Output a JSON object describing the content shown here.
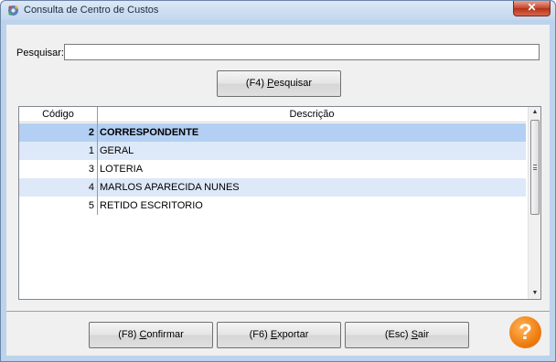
{
  "window": {
    "title": "Consulta de Centro de Custos",
    "close_glyph": "✕"
  },
  "search": {
    "label": "Pesquisar:",
    "value": "",
    "button_prefix": "(F4) ",
    "button_mnemonic": "P",
    "button_rest": "esquisar"
  },
  "grid": {
    "columns": [
      "Código",
      "Descrição"
    ],
    "rows": [
      {
        "code": "2",
        "description": "CORRESPONDENTE",
        "selected": true
      },
      {
        "code": "1",
        "description": "GERAL"
      },
      {
        "code": "3",
        "description": "LOTERIA"
      },
      {
        "code": "4",
        "description": "MARLOS APARECIDA NUNES"
      },
      {
        "code": "5",
        "description": "RETIDO ESCRITORIO"
      }
    ]
  },
  "footer": {
    "confirm_prefix": "(F8) ",
    "confirm_mnemonic": "C",
    "confirm_rest": "onfirmar",
    "export_prefix": "(F6) ",
    "export_mnemonic": "E",
    "export_rest": "xportar",
    "exit_prefix": "(Esc) ",
    "exit_mnemonic": "S",
    "exit_rest": "air",
    "help_glyph": "?"
  },
  "colors": {
    "selected_row": "#b3cff3",
    "alt_row": "#dde9f8",
    "help_accent": "#f07d10"
  },
  "icons": [
    "app-icon",
    "close-icon",
    "scroll-up-icon",
    "scroll-down-icon",
    "help-icon"
  ]
}
